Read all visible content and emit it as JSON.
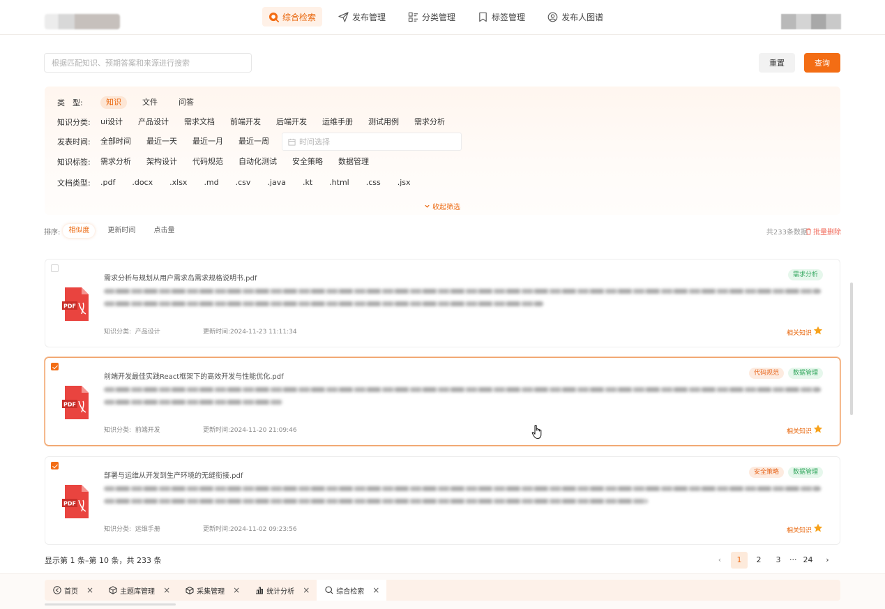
{
  "nav": {
    "items": [
      {
        "label": "综合检索",
        "icon": "search-icon",
        "active": true
      },
      {
        "label": "发布管理",
        "icon": "send-icon",
        "active": false
      },
      {
        "label": "分类管理",
        "icon": "category-icon",
        "active": false
      },
      {
        "label": "标签管理",
        "icon": "bookmark-icon",
        "active": false
      },
      {
        "label": "发布人图谱",
        "icon": "user-graph-icon",
        "active": false
      }
    ]
  },
  "search": {
    "placeholder": "根据匹配知识、预期答案和来源进行搜索",
    "value": "",
    "reset_label": "重置",
    "query_label": "查询"
  },
  "filters": {
    "type": {
      "label": "类　型:",
      "options": [
        "知识",
        "文件",
        "问答"
      ],
      "selected": "知识"
    },
    "category": {
      "label": "知识分类:",
      "options": [
        "ui设计",
        "产品设计",
        "需求文档",
        "前端开发",
        "后端开发",
        "运维手册",
        "测试用例",
        "需求分析"
      ]
    },
    "time": {
      "label": "发表时间:",
      "options": [
        "全部时间",
        "最近一天",
        "最近一月",
        "最近一周"
      ],
      "date_placeholder": "时间选择"
    },
    "tags": {
      "label": "知识标签:",
      "options": [
        "需求分析",
        "架构设计",
        "代码规范",
        "自动化测试",
        "安全策略",
        "数据管理"
      ]
    },
    "doctype": {
      "label": "文档类型:",
      "options": [
        ".pdf",
        ".docx",
        ".xlsx",
        ".md",
        ".csv",
        ".java",
        ".kt",
        ".html",
        ".css",
        ".jsx"
      ]
    },
    "collapse_label": "收起筛选"
  },
  "sort": {
    "label": "排序:",
    "options": [
      "相似度",
      "更新时间",
      "点击量"
    ],
    "selected": "相似度",
    "total": "共233条数据",
    "batch_delete": "批量删除"
  },
  "results": [
    {
      "title": "需求分析与规划从用户需求岛需求规格说明书.pdf",
      "category_label": "知识分类:",
      "category": "产品设计",
      "updated": "更新时间:2024-11-23 11:11:34",
      "tags": [
        {
          "text": "需求分析",
          "color": "green"
        }
      ],
      "related": "相关知识",
      "checked": false
    },
    {
      "title": "前端开发最佳实践React框架下的高效开发与性能优化.pdf",
      "category_label": "知识分类:",
      "category": "前端开发",
      "updated": "更新时间:2024-11-20 21:09:46",
      "tags": [
        {
          "text": "代码规范",
          "color": "orange"
        },
        {
          "text": "数据管理",
          "color": "green"
        }
      ],
      "related": "相关知识",
      "checked": true
    },
    {
      "title": "部署与运维从开发到生产环境的无缝衔接.pdf",
      "category_label": "知识分类:",
      "category": "运维手册",
      "updated": "更新时间:2024-11-02 09:23:56",
      "tags": [
        {
          "text": "安全策略",
          "color": "orange"
        },
        {
          "text": "数据管理",
          "color": "green"
        }
      ],
      "related": "相关知识",
      "checked": true
    }
  ],
  "pagination": {
    "info": "显示第 1 条–第 10 条，共 233 条",
    "pages": [
      "1",
      "2",
      "3",
      "···",
      "24"
    ],
    "current": "1",
    "prev": "‹",
    "next": "›"
  },
  "tabs": [
    {
      "label": "首页",
      "icon": "home-icon",
      "active": false
    },
    {
      "label": "主题库管理",
      "icon": "cube-icon",
      "active": false
    },
    {
      "label": "采集管理",
      "icon": "box-icon",
      "active": false
    },
    {
      "label": "统计分析",
      "icon": "bar-chart-icon",
      "active": false
    },
    {
      "label": "综合检索",
      "icon": "search-icon",
      "active": true
    }
  ],
  "colors": {
    "accent": "#f36d14",
    "accent_bg": "#fff1e7",
    "tag_green": "#35a860",
    "pdf_red": "#e9443f"
  }
}
